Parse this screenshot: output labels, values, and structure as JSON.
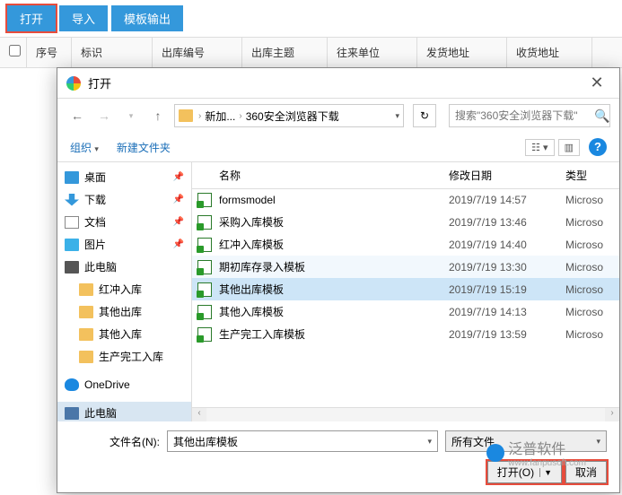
{
  "toolbar": {
    "open": "打开",
    "import": "导入",
    "template_output": "模板输出"
  },
  "columns": {
    "serial": "序号",
    "mark": "标识",
    "outbound_no": "出库编号",
    "outbound_subject": "出库主题",
    "partner": "往来单位",
    "ship_addr": "发货地址",
    "recv_addr": "收货地址"
  },
  "dialog": {
    "title": "打开",
    "breadcrumb": {
      "item1": "新加...",
      "item2": "360安全浏览器下载"
    },
    "search_placeholder": "搜索\"360安全浏览器下载\"",
    "organize": "组织",
    "new_folder": "新建文件夹",
    "tree": {
      "desktop": "桌面",
      "downloads": "下载",
      "documents": "文档",
      "pictures": "图片",
      "this_pc": "此电脑",
      "sub1": "红冲入库",
      "sub2": "其他出库",
      "sub3": "其他入库",
      "sub4": "生产完工入库",
      "onedrive": "OneDrive",
      "this_pc2": "此电脑"
    },
    "file_header": {
      "name": "名称",
      "date": "修改日期",
      "type": "类型"
    },
    "files": [
      {
        "name": "formsmodel",
        "date": "2019/7/19 14:57",
        "type": "Microso"
      },
      {
        "name": "采购入库模板",
        "date": "2019/7/19 13:46",
        "type": "Microso"
      },
      {
        "name": "红冲入库模板",
        "date": "2019/7/19 14:40",
        "type": "Microso"
      },
      {
        "name": "期初库存录入模板",
        "date": "2019/7/19 13:30",
        "type": "Microso"
      },
      {
        "name": "其他出库模板",
        "date": "2019/7/19 15:19",
        "type": "Microso"
      },
      {
        "name": "其他入库模板",
        "date": "2019/7/19 14:13",
        "type": "Microso"
      },
      {
        "name": "生产完工入库模板",
        "date": "2019/7/19 13:59",
        "type": "Microso"
      }
    ],
    "filename_label": "文件名(N):",
    "filename_value": "其他出库模板",
    "filter": "所有文件",
    "open_btn": "打开(O)",
    "cancel_btn": "取消"
  },
  "watermark": {
    "brand": "泛普软件",
    "url": "www.fanpusoft.com"
  }
}
